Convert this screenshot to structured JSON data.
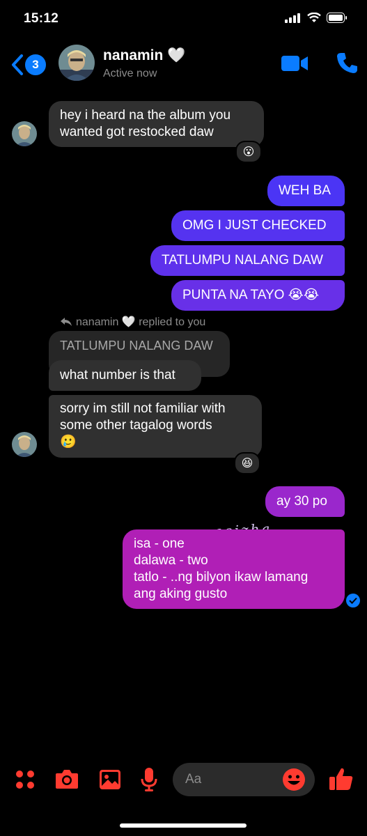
{
  "status": {
    "time": "15:12"
  },
  "header": {
    "back_count": "3",
    "name": "nanamin 🤍",
    "subtitle": "Active now"
  },
  "messages": [
    {
      "side": "in",
      "lines": [
        "hey i heard na the album you",
        "wanted got restocked daw"
      ],
      "reaction": "😮"
    },
    {
      "side": "out",
      "text": "WEH BA"
    },
    {
      "side": "out",
      "text": "OMG I JUST CHECKED"
    },
    {
      "side": "out",
      "text": "TATLUMPU NALANG DAW"
    },
    {
      "side": "out",
      "text": "PUNTA NA TAYO 😭😭"
    },
    {
      "side": "in",
      "reply_note": "nanamin 🤍 replied to you",
      "quoted": "TATLUMPU NALANG DAW",
      "text": "what number is that"
    },
    {
      "side": "in",
      "lines": [
        "sorry im still not familiar with",
        "some other tagalog words",
        "🥲"
      ],
      "reaction": "😆"
    },
    {
      "side": "out",
      "text": "ay 30 po"
    },
    {
      "side": "out",
      "lines": [
        "isa - one",
        "dalawa - two",
        "tatlo - ..ng bilyon ikaw lamang",
        "ang aking gusto"
      ]
    }
  ],
  "signature": "aeizha",
  "composer": {
    "placeholder": "Aa",
    "emoji": "😃"
  },
  "colors": {
    "accent": "#0a7cff",
    "toolbar": "#ff3b30",
    "bubble_in": "#303030",
    "bubble_out_top": "#4b35f5",
    "bubble_out_mid": "#7a2fe0",
    "bubble_out_bottom": "#b71fb4"
  },
  "icons": [
    "back-chevron-icon",
    "video-call-icon",
    "phone-icon",
    "apps-grid-icon",
    "camera-icon",
    "image-icon",
    "microphone-icon",
    "thumbs-up-icon",
    "reply-arrow-icon",
    "read-receipt-check-icon"
  ]
}
